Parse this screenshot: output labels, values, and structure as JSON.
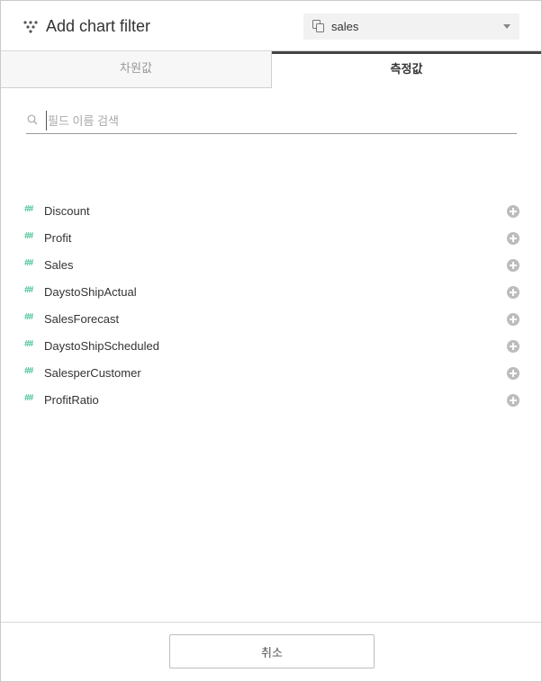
{
  "header": {
    "title": "Add chart filter",
    "datasource": {
      "value": "sales"
    }
  },
  "tabs": [
    {
      "label": "차원값",
      "active": false
    },
    {
      "label": "측정값",
      "active": true
    }
  ],
  "search": {
    "placeholder": "필드 이름 검색",
    "value": ""
  },
  "fields": [
    {
      "icon": "measure-icon",
      "glyph": "##",
      "name": "Discount"
    },
    {
      "icon": "measure-icon",
      "glyph": "##",
      "name": "Profit"
    },
    {
      "icon": "measure-icon",
      "glyph": "##",
      "name": "Sales"
    },
    {
      "icon": "measure-icon",
      "glyph": "##",
      "name": "DaystoShipActual"
    },
    {
      "icon": "measure-icon",
      "glyph": "##",
      "name": "SalesForecast"
    },
    {
      "icon": "measure-icon",
      "glyph": "##",
      "name": "DaystoShipScheduled"
    },
    {
      "icon": "measure-icon",
      "glyph": "##",
      "name": "SalesperCustomer"
    },
    {
      "icon": "measure-icon",
      "glyph": "##",
      "name": "ProfitRatio"
    }
  ],
  "footer": {
    "cancel_label": "취소"
  },
  "colors": {
    "measure": "#3fc08f",
    "active_tab_border": "#444444",
    "add_icon": "#bcbcbc"
  }
}
